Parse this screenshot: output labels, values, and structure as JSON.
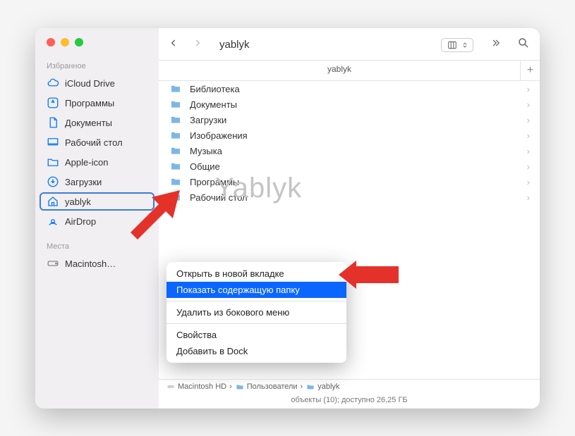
{
  "window_title": "yablyk",
  "watermark": "Yablyk",
  "tab_label": "yablyk",
  "sidebar": {
    "sections": [
      {
        "header": "Избранное",
        "items": [
          {
            "icon": "cloud",
            "label": "iCloud Drive"
          },
          {
            "icon": "apps",
            "label": "Программы"
          },
          {
            "icon": "doc",
            "label": "Документы"
          },
          {
            "icon": "desktop",
            "label": "Рабочий стол"
          },
          {
            "icon": "folder",
            "label": "Apple-icon"
          },
          {
            "icon": "download",
            "label": "Загрузки"
          },
          {
            "icon": "home",
            "label": "yablyk",
            "selected": true
          },
          {
            "icon": "airdrop",
            "label": "AirDrop"
          }
        ]
      },
      {
        "header": "Места",
        "items": [
          {
            "icon": "disk",
            "label": "Macintosh…",
            "gray": true
          }
        ]
      }
    ]
  },
  "files": [
    "Библиотека",
    "Документы",
    "Загрузки",
    "Изображения",
    "Музыка",
    "Общие",
    "Программы",
    "Рабочий стол"
  ],
  "context_menu": [
    {
      "label": "Открыть в новой вкладке"
    },
    {
      "label": "Показать содержащую папку",
      "hl": true
    },
    {
      "sep": true
    },
    {
      "label": "Удалить из бокового меню"
    },
    {
      "sep": true
    },
    {
      "label": "Свойства"
    },
    {
      "label": "Добавить в Dock"
    }
  ],
  "pathbar": [
    "Macintosh HD",
    "Пользователи",
    "yablyk"
  ],
  "statusbar": "объекты (10); доступно 26,25 ГБ"
}
